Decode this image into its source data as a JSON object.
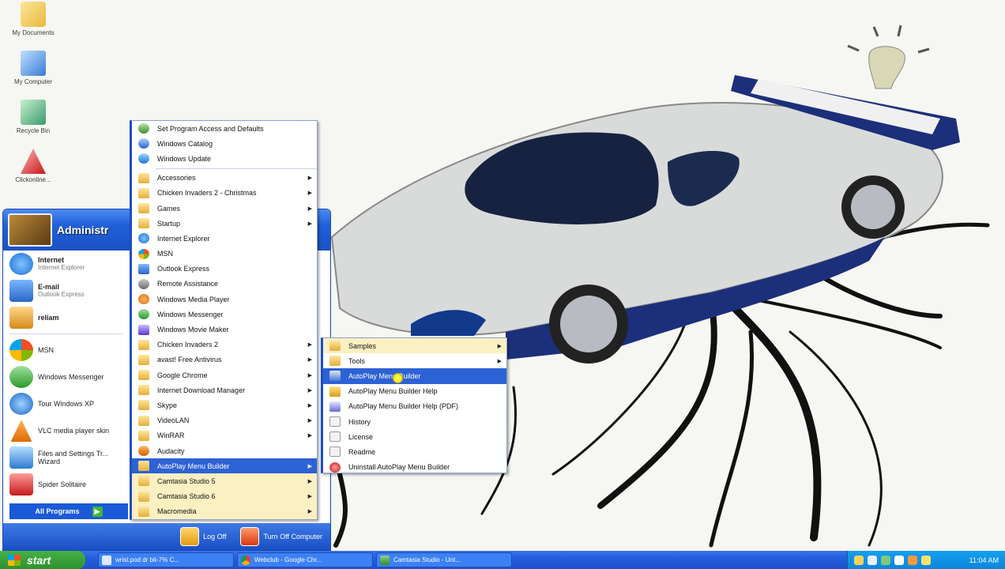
{
  "desktop": {
    "icons": [
      {
        "label": "My Documents",
        "icon": "folder-documents-icon"
      },
      {
        "label": "My Computer",
        "icon": "computer-icon"
      },
      {
        "label": "Recycle Bin",
        "icon": "recycle-bin-icon"
      },
      {
        "label": "Clickonline...",
        "icon": "app-shortcut-icon"
      }
    ]
  },
  "start_menu": {
    "user": "Administr",
    "pinned": [
      {
        "title": "Internet",
        "subtitle": "Internet Explorer",
        "icon": "internet-explorer-icon"
      },
      {
        "title": "E-mail",
        "subtitle": "Outlook Express",
        "icon": "email-icon"
      },
      {
        "title": "reliam",
        "subtitle": "",
        "icon": "app-icon"
      }
    ],
    "recent": [
      {
        "title": "MSN",
        "icon": "msn-icon"
      },
      {
        "title": "Windows Messenger",
        "icon": "messenger-icon"
      },
      {
        "title": "Tour Windows XP",
        "icon": "tour-icon"
      },
      {
        "title": "VLC media player skin",
        "icon": "vlc-icon"
      },
      {
        "title": "Files and Settings Tr... Wizard",
        "icon": "transfer-wizard-icon"
      },
      {
        "title": "Spider Solitaire",
        "icon": "solitaire-icon"
      }
    ],
    "all_programs": "All Programs",
    "log_off": "Log Off",
    "turn_off": "Turn Off Computer"
  },
  "programs_menu": {
    "items": [
      {
        "label": "Set Program Access and Defaults",
        "icon": "defaults-icon",
        "submenu": false
      },
      {
        "label": "Windows Catalog",
        "icon": "catalog-icon",
        "submenu": false
      },
      {
        "label": "Windows Update",
        "icon": "update-icon",
        "submenu": false
      },
      {
        "label": "Accessories",
        "icon": "folder-icon",
        "submenu": true
      },
      {
        "label": "Chicken Invaders 2 - Christmas",
        "icon": "folder-icon",
        "submenu": true
      },
      {
        "label": "Games",
        "icon": "folder-icon",
        "submenu": true
      },
      {
        "label": "Startup",
        "icon": "folder-icon",
        "submenu": true
      },
      {
        "label": "Internet Explorer",
        "icon": "internet-explorer-icon",
        "submenu": false
      },
      {
        "label": "MSN",
        "icon": "msn-icon",
        "submenu": false
      },
      {
        "label": "Outlook Express",
        "icon": "email-icon",
        "submenu": false
      },
      {
        "label": "Remote Assistance",
        "icon": "remote-icon",
        "submenu": false
      },
      {
        "label": "Windows Media Player",
        "icon": "media-player-icon",
        "submenu": false
      },
      {
        "label": "Windows Messenger",
        "icon": "messenger-icon",
        "submenu": false
      },
      {
        "label": "Windows Movie Maker",
        "icon": "movie-maker-icon",
        "submenu": false
      },
      {
        "label": "Chicken Invaders 2",
        "icon": "folder-icon",
        "submenu": true
      },
      {
        "label": "avast! Free Antivirus",
        "icon": "folder-icon",
        "submenu": true
      },
      {
        "label": "Google Chrome",
        "icon": "folder-icon",
        "submenu": true
      },
      {
        "label": "Internet Download Manager",
        "icon": "folder-icon",
        "submenu": true
      },
      {
        "label": "Skype",
        "icon": "folder-icon",
        "submenu": true
      },
      {
        "label": "VideoLAN",
        "icon": "folder-icon",
        "submenu": true
      },
      {
        "label": "WinRAR",
        "icon": "folder-icon",
        "submenu": true
      },
      {
        "label": "Audacity",
        "icon": "audacity-icon",
        "submenu": false
      },
      {
        "label": "AutoPlay Menu Builder",
        "icon": "folder-icon",
        "submenu": true,
        "highlighted": true
      },
      {
        "label": "Camtasia Studio 5",
        "icon": "folder-icon",
        "submenu": true,
        "new": true
      },
      {
        "label": "Camtasia Studio 6",
        "icon": "folder-icon",
        "submenu": true,
        "new": true
      },
      {
        "label": "Macromedia",
        "icon": "folder-icon",
        "submenu": true,
        "new": true
      }
    ]
  },
  "autoplay_menu": {
    "items": [
      {
        "label": "Samples",
        "icon": "folder-icon",
        "submenu": true,
        "new": true
      },
      {
        "label": "Tools",
        "icon": "folder-icon",
        "submenu": true
      },
      {
        "label": "AutoPlay Menu Builder",
        "icon": "autoplay-icon",
        "submenu": false,
        "highlighted": true
      },
      {
        "label": "AutoPlay Menu Builder Help",
        "icon": "help-icon",
        "submenu": false
      },
      {
        "label": "AutoPlay Menu Builder Help (PDF)",
        "icon": "pdf-icon",
        "submenu": false
      },
      {
        "label": "History",
        "icon": "document-icon",
        "submenu": false
      },
      {
        "label": "License",
        "icon": "document-icon",
        "submenu": false
      },
      {
        "label": "Readme",
        "icon": "document-icon",
        "submenu": false
      },
      {
        "label": "Uninstall AutoPlay Menu Builder",
        "icon": "uninstall-icon",
        "submenu": false
      }
    ]
  },
  "taskbar": {
    "start_label": "start",
    "tasks": [
      {
        "label": "wrist.pod dr bit-7% C...",
        "icon": "document-icon"
      },
      {
        "label": "Webclub - Google Chr...",
        "icon": "chrome-icon"
      },
      {
        "label": "Camtasia Studio - Unt...",
        "icon": "camtasia-icon"
      }
    ],
    "clock": "11:04 AM"
  },
  "colors": {
    "xp_blue": "#245ddb",
    "menu_highlight": "#2d62d4",
    "new_program": "#fbf0c2",
    "start_green": "#2d922d",
    "tray_blue": "#0c85db"
  }
}
